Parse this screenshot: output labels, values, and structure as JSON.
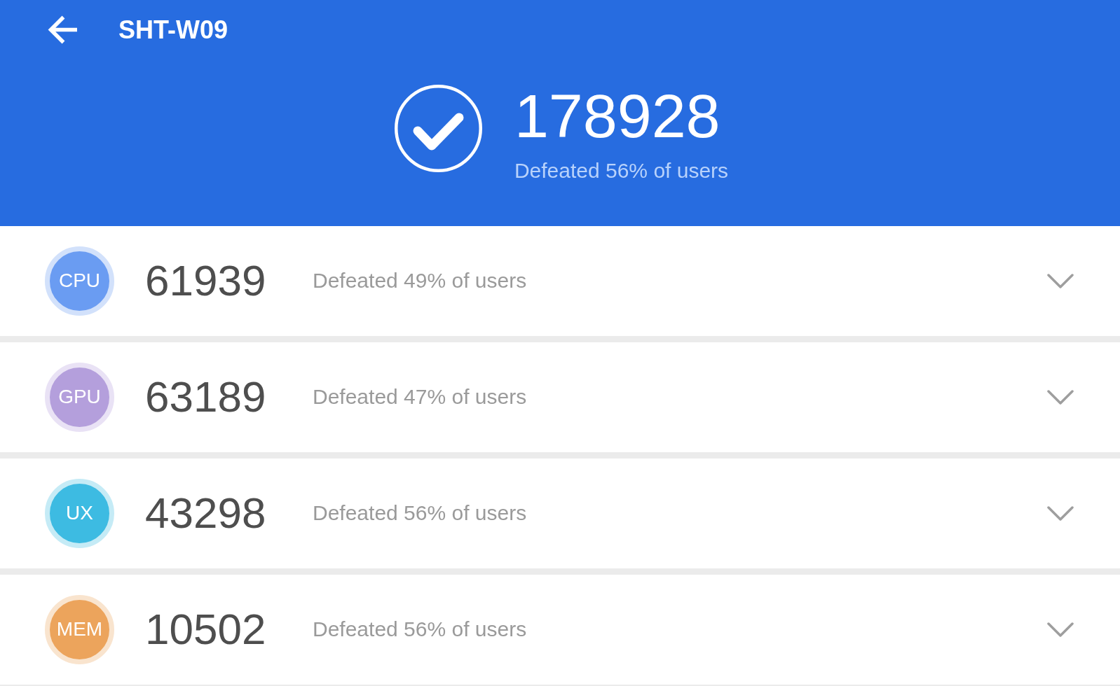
{
  "header": {
    "title": "SHT-W09",
    "total_score": "178928",
    "total_rank": "Defeated 56% of users"
  },
  "results": [
    {
      "label": "CPU",
      "color": "#6a9cf2",
      "score": "61939",
      "rank": "Defeated 49% of users",
      "expanded": false
    },
    {
      "label": "GPU",
      "color": "#b49fdc",
      "score": "63189",
      "rank": "Defeated 47% of users",
      "expanded": false
    },
    {
      "label": "UX",
      "color": "#3dbbe2",
      "score": "43298",
      "rank": "Defeated 56% of users",
      "expanded": false
    },
    {
      "label": "MEM",
      "color": "#eca45c",
      "score": "10502",
      "rank": "Defeated 56% of users",
      "expanded": false
    }
  ]
}
